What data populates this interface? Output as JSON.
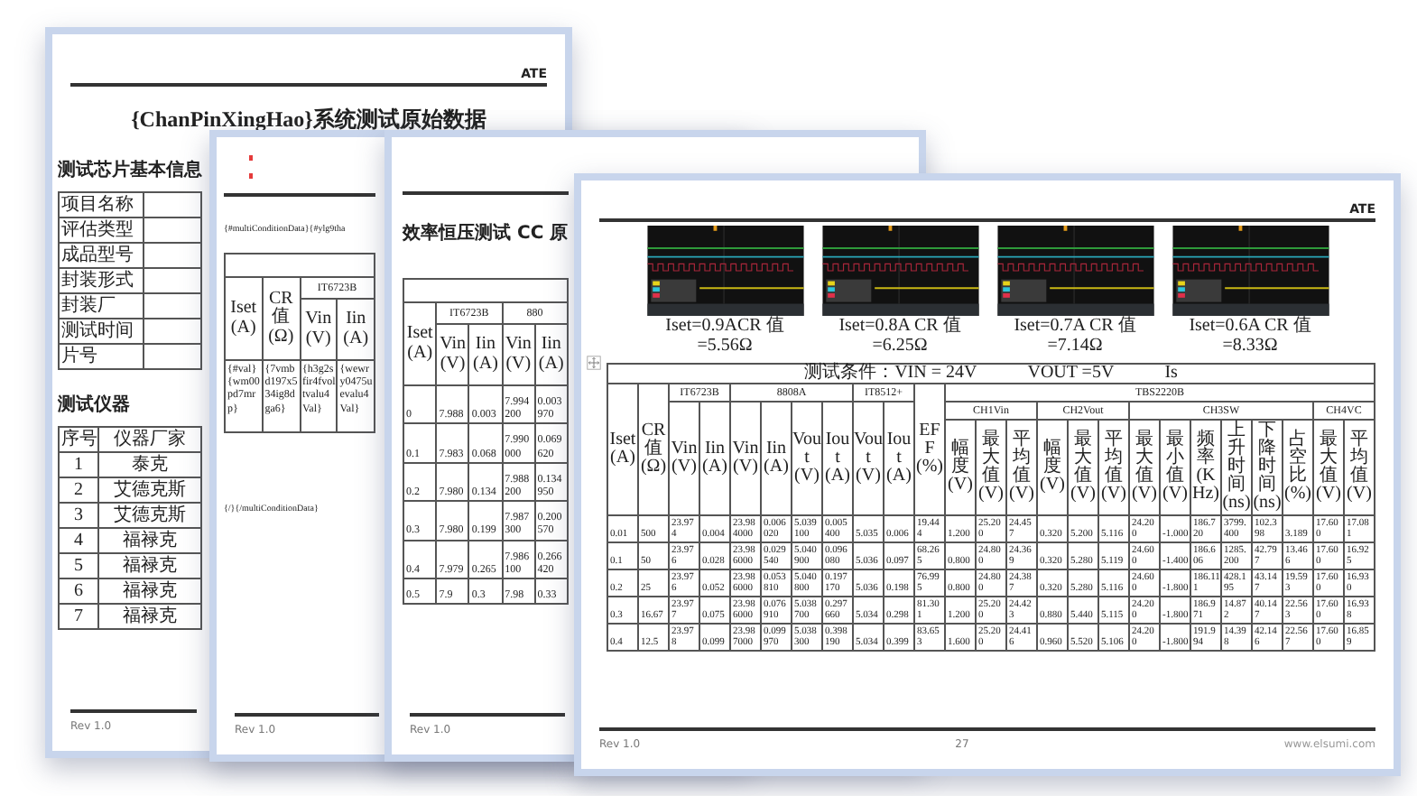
{
  "info_page": {
    "header": "ATE",
    "title": "{ChanPinXingHao}系统测试原始数据",
    "chip_info": {
      "heading": "测试芯片基本信息",
      "fields": [
        "项目名称",
        "评估类型",
        "成品型号",
        "封装形式",
        "封装厂",
        "测试时间",
        "片号"
      ]
    },
    "instruments": {
      "heading": "测试仪器",
      "columns": [
        "序号",
        "仪器厂家"
      ],
      "rows": [
        [
          "1",
          "泰克"
        ],
        [
          "2",
          "艾德克斯"
        ],
        [
          "3",
          "艾德克斯"
        ],
        [
          "4",
          "福禄克"
        ],
        [
          "5",
          "福禄克"
        ],
        [
          "6",
          "福禄克"
        ],
        [
          "7",
          "福禄克"
        ]
      ]
    },
    "footer": "Rev 1.0"
  },
  "template_page": {
    "start_tag": "{#multiConditionData}{#ylg9tha",
    "table": {
      "header_rows": [
        [
          {
            "text": "Iset(A)",
            "rowspan": 2
          },
          {
            "text": "CR值(Ω)",
            "rowspan": 2
          },
          {
            "text": "IT6723B",
            "colspan": 2
          }
        ],
        [
          {
            "text": "Vin(V)"
          },
          {
            "text": "Iin(A)"
          }
        ]
      ],
      "rows": [
        [
          "{#val}{wm00pd7mrp}",
          "{7vmbd197x534ig8dga6}",
          "{h3g2sfir4fvoltvalu4Val}",
          "{wewry0475uevalu4Val}"
        ]
      ]
    },
    "end_tag": "{/}{/multiConditionData}",
    "footer": "Rev 1.0"
  },
  "cc_page": {
    "title": "效率恒压测试 CC 原",
    "table": {
      "header_rows": [
        [
          {
            "text": "Iset(A)",
            "rowspan": 2
          },
          {
            "text": "IT6723B",
            "colspan": 2
          },
          {
            "text": "880",
            "colspan": 2
          }
        ],
        [
          {
            "text": "Vin(V)"
          },
          {
            "text": "Iin(A)"
          },
          {
            "text": "Vin(V)"
          },
          {
            "text": "Iin(A)"
          }
        ]
      ],
      "rows": [
        [
          "0",
          "7.988",
          "0.003",
          "7.994200",
          "0.003970"
        ],
        [
          "0.1",
          "7.983",
          "0.068",
          "7.990000",
          "0.069620"
        ],
        [
          "0.2",
          "7.980",
          "0.134",
          "7.988200",
          "0.134950"
        ],
        [
          "0.3",
          "7.980",
          "0.199",
          "7.987300",
          "0.200570"
        ],
        [
          "0.4",
          "7.979",
          "0.265",
          "7.986100",
          "0.266420"
        ],
        [
          "0.5",
          "7.9",
          "0.3",
          "7.98",
          "0.33"
        ]
      ]
    },
    "footer": "Rev 1.0"
  },
  "efficiency_page": {
    "header": "ATE",
    "shots": [
      {
        "caption": "Iset=0.9ACR 值=5.56Ω"
      },
      {
        "caption": "Iset=0.8A CR 值=6.25Ω"
      },
      {
        "caption": "Iset=0.7A CR 值=7.14Ω"
      },
      {
        "caption": "Iset=0.6A CR 值=8.33Ω"
      }
    ],
    "table": {
      "condition": [
        "测试条件：VIN = 24V",
        "VOUT =5V",
        "Is"
      ],
      "header_rows": [
        [
          {
            "text": "Iset(A)",
            "rowspan": 3
          },
          {
            "text": "CR值(Ω)",
            "rowspan": 3
          },
          {
            "text": "IT6723B",
            "colspan": 2
          },
          {
            "text": "8808A",
            "colspan": 4
          },
          {
            "text": "IT8512+",
            "colspan": 2
          },
          {
            "text": "EFF(%)",
            "rowspan": 3
          },
          {
            "text": "TBS2220B",
            "colspan": 14
          }
        ],
        [
          {
            "text": "Vin(V)",
            "rowspan": 2
          },
          {
            "text": "Iin(A)",
            "rowspan": 2
          },
          {
            "text": "Vin(V)",
            "rowspan": 2
          },
          {
            "text": "Iin(A)",
            "rowspan": 2
          },
          {
            "text": "Vout(V)",
            "rowspan": 2
          },
          {
            "text": "Iout(A)",
            "rowspan": 2
          },
          {
            "text": "Vout(V)",
            "rowspan": 2
          },
          {
            "text": "Iout(A)",
            "rowspan": 2
          },
          {
            "text": "CH1Vin",
            "colspan": 3
          },
          {
            "text": "CH2Vout",
            "colspan": 3
          },
          {
            "text": "CH3SW",
            "colspan": 6
          },
          {
            "text": "CH4VC",
            "colspan": 2
          }
        ],
        [
          {
            "text": "幅度(V)"
          },
          {
            "text": "最大值(V)"
          },
          {
            "text": "平均值(V)"
          },
          {
            "text": "幅度(V)"
          },
          {
            "text": "最大值(V)"
          },
          {
            "text": "平均值(V)"
          },
          {
            "text": "最大值(V)"
          },
          {
            "text": "最小值(V)"
          },
          {
            "text": "频率(KHz)"
          },
          {
            "text": "上升时间(ns)"
          },
          {
            "text": "下降时间(ns)"
          },
          {
            "text": "占空比(%)"
          },
          {
            "text": "最大值(V)"
          },
          {
            "text": "平均值(V)"
          }
        ]
      ],
      "rows": [
        [
          "0.01",
          "500",
          "23.974",
          "0.004",
          "23.984000",
          "0.006020",
          "5.039100",
          "0.005400",
          "5.035",
          "0.006",
          "19.444",
          "1.200",
          "25.200",
          "24.457",
          "0.320",
          "5.200",
          "5.116",
          "24.200",
          "-1.000",
          "186.720",
          "3799.400",
          "102.398",
          "3.189",
          "17.600",
          "17.081"
        ],
        [
          "0.1",
          "50",
          "23.976",
          "0.028",
          "23.986000",
          "0.029540",
          "5.040900",
          "0.096080",
          "5.036",
          "0.097",
          "68.265",
          "0.800",
          "24.800",
          "24.369",
          "0.320",
          "5.280",
          "5.119",
          "24.600",
          "-1.400",
          "186.606",
          "1285.200",
          "42.797",
          "13.466",
          "17.600",
          "16.925"
        ],
        [
          "0.2",
          "25",
          "23.976",
          "0.052",
          "23.986000",
          "0.053810",
          "5.040800",
          "0.197170",
          "5.036",
          "0.198",
          "76.995",
          "0.800",
          "24.800",
          "24.387",
          "0.320",
          "5.280",
          "5.116",
          "24.600",
          "-1.800",
          "186.111",
          "428.195",
          "43.147",
          "19.593",
          "17.600",
          "16.930"
        ],
        [
          "0.3",
          "16.67",
          "23.977",
          "0.075",
          "23.986000",
          "0.076910",
          "5.038700",
          "0.297660",
          "5.034",
          "0.298",
          "81.301",
          "1.200",
          "25.200",
          "24.423",
          "0.880",
          "5.440",
          "5.115",
          "24.200",
          "-1.800",
          "186.971",
          "14.872",
          "40.147",
          "22.563",
          "17.600",
          "16.938"
        ],
        [
          "0.4",
          "12.5",
          "23.978",
          "0.099",
          "23.987000",
          "0.099970",
          "5.038300",
          "0.398190",
          "5.034",
          "0.399",
          "83.653",
          "1.600",
          "25.200",
          "24.416",
          "0.960",
          "5.520",
          "5.106",
          "24.200",
          "-1.800",
          "191.994",
          "14.398",
          "42.146",
          "22.567",
          "17.600",
          "16.859"
        ]
      ]
    },
    "page_number": "27",
    "website": "www.elsumi.com",
    "footer": "Rev 1.0"
  }
}
